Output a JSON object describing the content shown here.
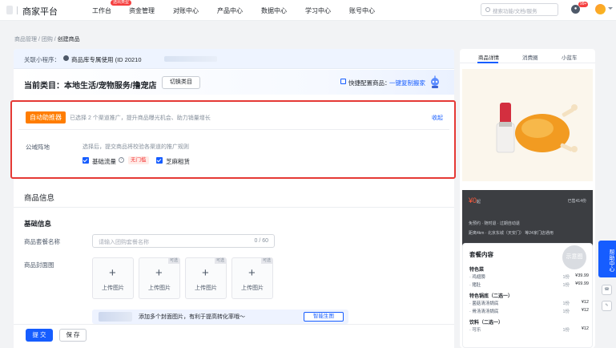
{
  "topbar": {
    "logo": "商家平台",
    "nav": [
      "工作台",
      "资金管理",
      "对账中心",
      "产品中心",
      "数据中心",
      "学习中心",
      "账号中心"
    ],
    "nav_badge": "透出类型",
    "search_placeholder": "搜索功能/文档/服务",
    "notice_badge": "99+"
  },
  "breadcrumb": [
    "商品管理",
    "团购",
    "创建商品"
  ],
  "mini_program": {
    "label": "关联小程序：",
    "value": "商品库专属使用 (ID 20210"
  },
  "category": {
    "title": "当前类目：本地生活/宠物服务/撸宠店",
    "switch_label": "切换类目",
    "quick_label": "快捷配置商品：",
    "quick_link": "一键复制搬家"
  },
  "promo": {
    "tag": "自动助推器",
    "desc": "已选择 2 个渠道推广，提升商品曝光机会、助力销量增长",
    "collapse": "收起",
    "field_label": "公域阵地",
    "hint": "选择后，提交商品将校验各渠道的推广规则",
    "options": [
      {
        "label": "基础流量",
        "checked": true,
        "badge": "无门槛"
      },
      {
        "label": "芝麻租赁",
        "checked": true
      }
    ]
  },
  "product_info": {
    "title": "商品信息",
    "basic_title": "基础信息",
    "name_label": "商品套餐名称",
    "name_placeholder": "请输入团购套餐名称",
    "name_count": "0 / 60",
    "cover_label": "商品封面图",
    "upload_label": "上传图片",
    "optional_tag": "可选",
    "ai_text": "添加多个封面图片，有利于提高转化率哦～",
    "ai_button": "智能生图"
  },
  "footer": {
    "submit": "提 交",
    "save": "保 存"
  },
  "preview": {
    "tabs": [
      "商品详情",
      "消费圈",
      "小蓝车"
    ],
    "price": "¥0",
    "price_unit": "起",
    "sold": "已售414份",
    "line1": "免预约 · 随时退 · 过期自动退",
    "line2": "距离4km · 北京东城（天安门） 等24家门店通用",
    "content_title": "套餐内容",
    "stamp": "示意图",
    "groups": [
      {
        "name": "特色菜",
        "items": [
          {
            "name": "鸡翅膀",
            "qty": "1份",
            "price": "¥39.99"
          },
          {
            "name": "猪肚",
            "qty": "1份",
            "price": "¥69.99"
          }
        ]
      },
      {
        "name": "特色锅底（二选一）",
        "items": [
          {
            "name": "菌菇清汤锅底",
            "qty": "1份",
            "price": "¥12"
          },
          {
            "name": "骨汤清汤锅底",
            "qty": "1份",
            "price": "¥12"
          }
        ]
      },
      {
        "name": "饮料（二选一）",
        "items": [
          {
            "name": "可乐",
            "qty": "1份",
            "price": "¥12"
          }
        ]
      }
    ]
  },
  "help": "帮助中心"
}
